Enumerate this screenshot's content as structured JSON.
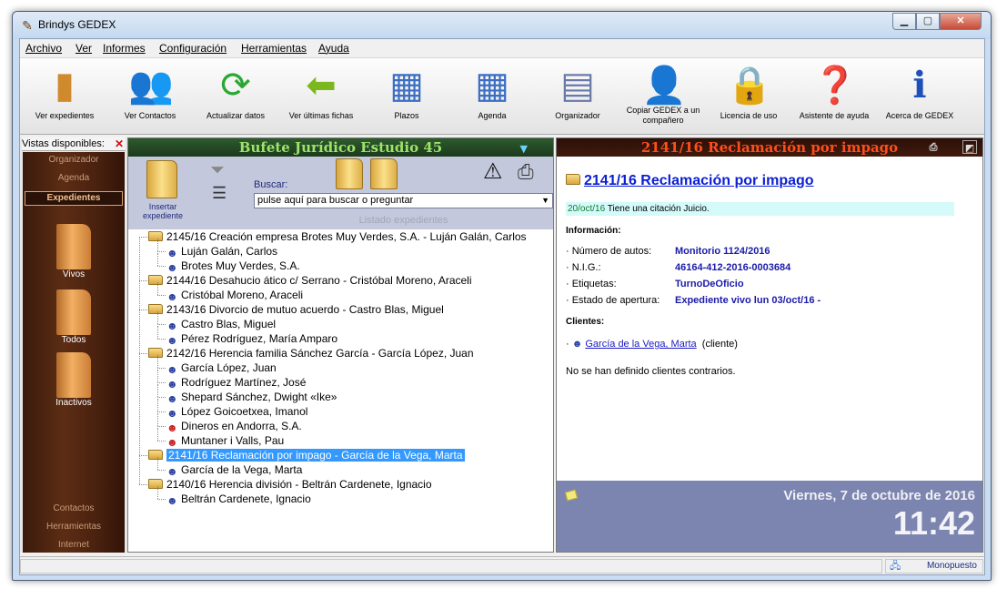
{
  "window": {
    "title": "Brindys GEDEX"
  },
  "menu": [
    "Archivo",
    "Ver",
    "Informes",
    "Configuración",
    "Herramientas",
    "Ayuda"
  ],
  "toolbar": [
    {
      "label": "Ver expedientes",
      "icon": "folder-icon"
    },
    {
      "label": "Ver Contactos",
      "icon": "contacts-icon"
    },
    {
      "label": "Actualizar datos",
      "icon": "refresh-icon"
    },
    {
      "label": "Ver últimas fichas",
      "icon": "back-arrow-icon"
    },
    {
      "label": "Plazos",
      "icon": "calendar-clock-icon"
    },
    {
      "label": "Agenda",
      "icon": "agenda-icon"
    },
    {
      "label": "Organizador",
      "icon": "organizer-icon"
    },
    {
      "label": "Copiar GEDEX a un compañero",
      "icon": "copy-user-icon"
    },
    {
      "label": "Licencia de uso",
      "icon": "padlock-icon"
    },
    {
      "label": "Asistente de ayuda",
      "icon": "help-icon"
    },
    {
      "label": "Acerca de GEDEX",
      "icon": "info-icon"
    }
  ],
  "sidebar": {
    "header": "Vistas disponibles:",
    "top_links": [
      "Organizador",
      "Agenda"
    ],
    "active": "Expedientes",
    "views": [
      "Vivos",
      "Todos",
      "Inactivos"
    ],
    "bottom_links": [
      "Contactos",
      "Herramientas",
      "Internet"
    ]
  },
  "middle": {
    "title": "Bufete Jurídico Estudio 45",
    "insert_label": "Insertar expediente",
    "search_label": "Buscar:",
    "search_placeholder": "pulse aquí para buscar o preguntar",
    "list_label": "Listado expedientes",
    "tree": [
      {
        "type": "folder",
        "text": "2145/16 Creación empresa Brotes Muy Verdes, S.A.  - Luján Galán, Carlos"
      },
      {
        "type": "person",
        "text": "Luján Galán, Carlos"
      },
      {
        "type": "person",
        "text": "Brotes Muy Verdes, S.A."
      },
      {
        "type": "folder",
        "text": "2144/16 Desahucio ático c/ Serrano  - Cristóbal Moreno, Araceli"
      },
      {
        "type": "person",
        "text": "Cristóbal Moreno, Araceli"
      },
      {
        "type": "folder",
        "text": "2143/16 Divorcio de mutuo acuerdo  - Castro Blas, Miguel"
      },
      {
        "type": "person",
        "text": "Castro Blas, Miguel"
      },
      {
        "type": "person",
        "text": "Pérez Rodríguez, María Amparo"
      },
      {
        "type": "folder",
        "text": "2142/16 Herencia familia Sánchez García  - García López, Juan"
      },
      {
        "type": "person",
        "text": "García López, Juan"
      },
      {
        "type": "person",
        "text": "Rodríguez Martínez, José"
      },
      {
        "type": "person",
        "text": "Shepard Sánchez, Dwight «Ike»"
      },
      {
        "type": "person",
        "text": "López Goicoetxea, Imanol"
      },
      {
        "type": "person-red",
        "text": "Dineros en Andorra, S.A."
      },
      {
        "type": "person-red",
        "text": "Muntaner i Valls, Pau"
      },
      {
        "type": "folder",
        "text": "2141/16 Reclamación por impago  - García de la Vega, Marta",
        "selected": true
      },
      {
        "type": "person",
        "text": "García de la Vega, Marta"
      },
      {
        "type": "folder",
        "text": "2140/16 Herencia división  - Beltrán Cardenete, Ignacio"
      },
      {
        "type": "person",
        "text": "Beltrán Cardenete, Ignacio"
      }
    ]
  },
  "detail": {
    "header": "2141/16 Reclamación por impago",
    "title": "2141/16 Reclamación por impago",
    "note_date": "20/oct/16",
    "note_text": "Tiene una citación Juicio.",
    "info_label": "Información:",
    "fields": [
      {
        "key": "· Número de autos:",
        "value": "Monitorio 1124/2016"
      },
      {
        "key": "· N.I.G.:",
        "value": "46164-412-2016-0003684"
      },
      {
        "key": "· Etiquetas:",
        "value": "TurnoDeOficio"
      },
      {
        "key": "· Estado de apertura:",
        "value": "Expediente vivo lun 03/oct/16 -"
      }
    ],
    "clients_label": "Clientes:",
    "client_name": "García de la Vega, Marta",
    "client_role": "(cliente)",
    "no_contrary": "No se han definido clientes contrarios.",
    "date_text": "Viernes, 7 de octubre de 2016",
    "time_text": "11:42"
  },
  "status": {
    "mode": "Monopuesto"
  },
  "colors": {
    "mid_header_text": "#9ee36a",
    "right_header_text": "#ff4e1b",
    "selection": "#3399ff",
    "link": "#0b1fd2"
  }
}
